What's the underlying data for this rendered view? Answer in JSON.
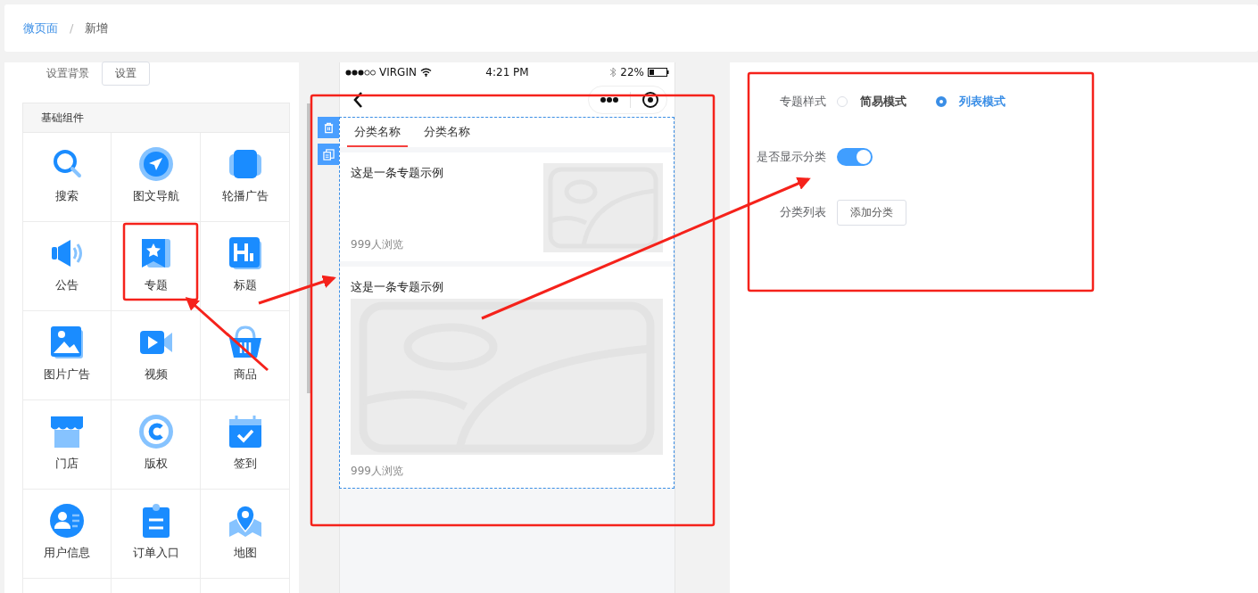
{
  "breadcrumb": [
    {
      "label": "微页面",
      "link": true
    },
    {
      "label": "新增",
      "link": false
    }
  ],
  "breadcrumb_separator": "/",
  "background_setting": {
    "label": "设置背景",
    "button": "设置"
  },
  "component_group": {
    "title": "基础组件",
    "items": [
      {
        "label": "搜索"
      },
      {
        "label": "图文导航"
      },
      {
        "label": "轮播广告"
      },
      {
        "label": "公告"
      },
      {
        "label": "专题"
      },
      {
        "label": "标题"
      },
      {
        "label": "图片广告"
      },
      {
        "label": "视频"
      },
      {
        "label": "商品"
      },
      {
        "label": "门店"
      },
      {
        "label": "版权"
      },
      {
        "label": "签到"
      },
      {
        "label": "用户信息"
      },
      {
        "label": "订单入口"
      },
      {
        "label": "地图"
      }
    ]
  },
  "phone": {
    "carrier": "VIRGIN",
    "time": "4:21 PM",
    "battery": "22%",
    "tabs": [
      {
        "label": "分类名称",
        "selected": true
      },
      {
        "label": "分类名称",
        "selected": false
      }
    ],
    "topics": [
      {
        "kind": "small",
        "title": "这是一条专题示例",
        "views": "999人浏览"
      },
      {
        "kind": "large",
        "title": "这是一条专题示例",
        "views": "999人浏览"
      }
    ]
  },
  "settings": {
    "style_label": "专题样式",
    "styles": [
      {
        "label": "简易模式",
        "selected": false
      },
      {
        "label": "列表模式",
        "selected": true
      }
    ],
    "show_category_label": "是否显示分类",
    "show_category": {
      "on": true
    },
    "category_list_label": "分类列表",
    "add_button": "添加分类"
  }
}
